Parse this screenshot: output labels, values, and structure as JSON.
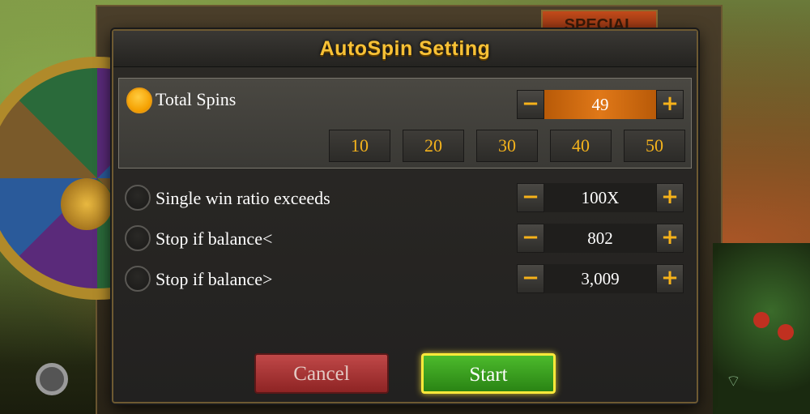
{
  "modal": {
    "title": "AutoSpin Setting",
    "total_spins": {
      "label": "Total Spins",
      "selected": true,
      "value": "49",
      "presets": [
        "10",
        "20",
        "30",
        "40",
        "50"
      ]
    },
    "single_win": {
      "label": "Single win ratio exceeds",
      "selected": false,
      "value": "100X"
    },
    "balance_below": {
      "label": "Stop if balance<",
      "selected": false,
      "value": "802"
    },
    "balance_above": {
      "label": "Stop if balance>",
      "selected": false,
      "value": "3,009"
    },
    "minus_symbol": "−",
    "plus_symbol": "+",
    "cancel_label": "Cancel",
    "start_label": "Start"
  },
  "background": {
    "banner_text": "SPECIAL"
  },
  "colors": {
    "accent_gold": "#f7c136",
    "selected_orange": "#f5a000",
    "start_green": "#3aa020",
    "cancel_red": "#a83434"
  },
  "icons": [
    "settings-gear-icon",
    "wifi-icon",
    "minus-icon",
    "plus-icon"
  ]
}
